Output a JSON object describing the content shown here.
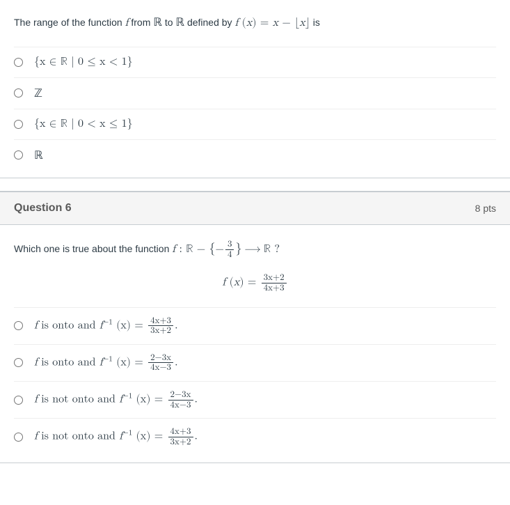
{
  "q5": {
    "prompt_pre": "The range of the function ",
    "prompt_f": "f",
    "prompt_mid1": " from ",
    "prompt_R1": "ℝ",
    "prompt_mid2": " to ",
    "prompt_R2": "ℝ",
    "prompt_mid3": " defined by ",
    "prompt_eq": "f (x) = x − ⌊x⌋",
    "prompt_post": " is",
    "answers": [
      "{x ∈ ℝ |  0 ≤ x < 1}",
      "ℤ",
      "{x ∈ ℝ |  0 < x ≤ 1}",
      "ℝ"
    ]
  },
  "q6": {
    "title": "Question 6",
    "pts": "8 pts",
    "prompt_pre": "Which one is true about the function ",
    "prompt_func_part1": "f : ℝ − {−",
    "prompt_frac_num": "3",
    "prompt_frac_den": "4",
    "prompt_func_part2": "} ⟶ ℝ ?",
    "eq_lhs": "f (x) = ",
    "eq_num": "3x+2",
    "eq_den": "4x+3",
    "answers": [
      {
        "pre": "f",
        "mid": " is onto and  ",
        "inv": "f",
        "sup": "−1",
        "paren": " (x) = ",
        "num": "4x+3",
        "den": "3x+2",
        "post": "."
      },
      {
        "pre": "f",
        "mid": " is onto and  ",
        "inv": "f",
        "sup": "−1",
        "paren": " (x) = ",
        "num": "2−3x",
        "den": "4x−3",
        "post": "."
      },
      {
        "pre": "f",
        "mid": "  is not onto and  ",
        "inv": "f",
        "sup": "−1",
        "paren": " (x) = ",
        "num": "2−3x",
        "den": "4x−3",
        "post": "."
      },
      {
        "pre": "f",
        "mid": " is not onto and  ",
        "inv": "f",
        "sup": "−1",
        "paren": " (x) = ",
        "num": "4x+3",
        "den": "3x+2",
        "post": "."
      }
    ]
  }
}
